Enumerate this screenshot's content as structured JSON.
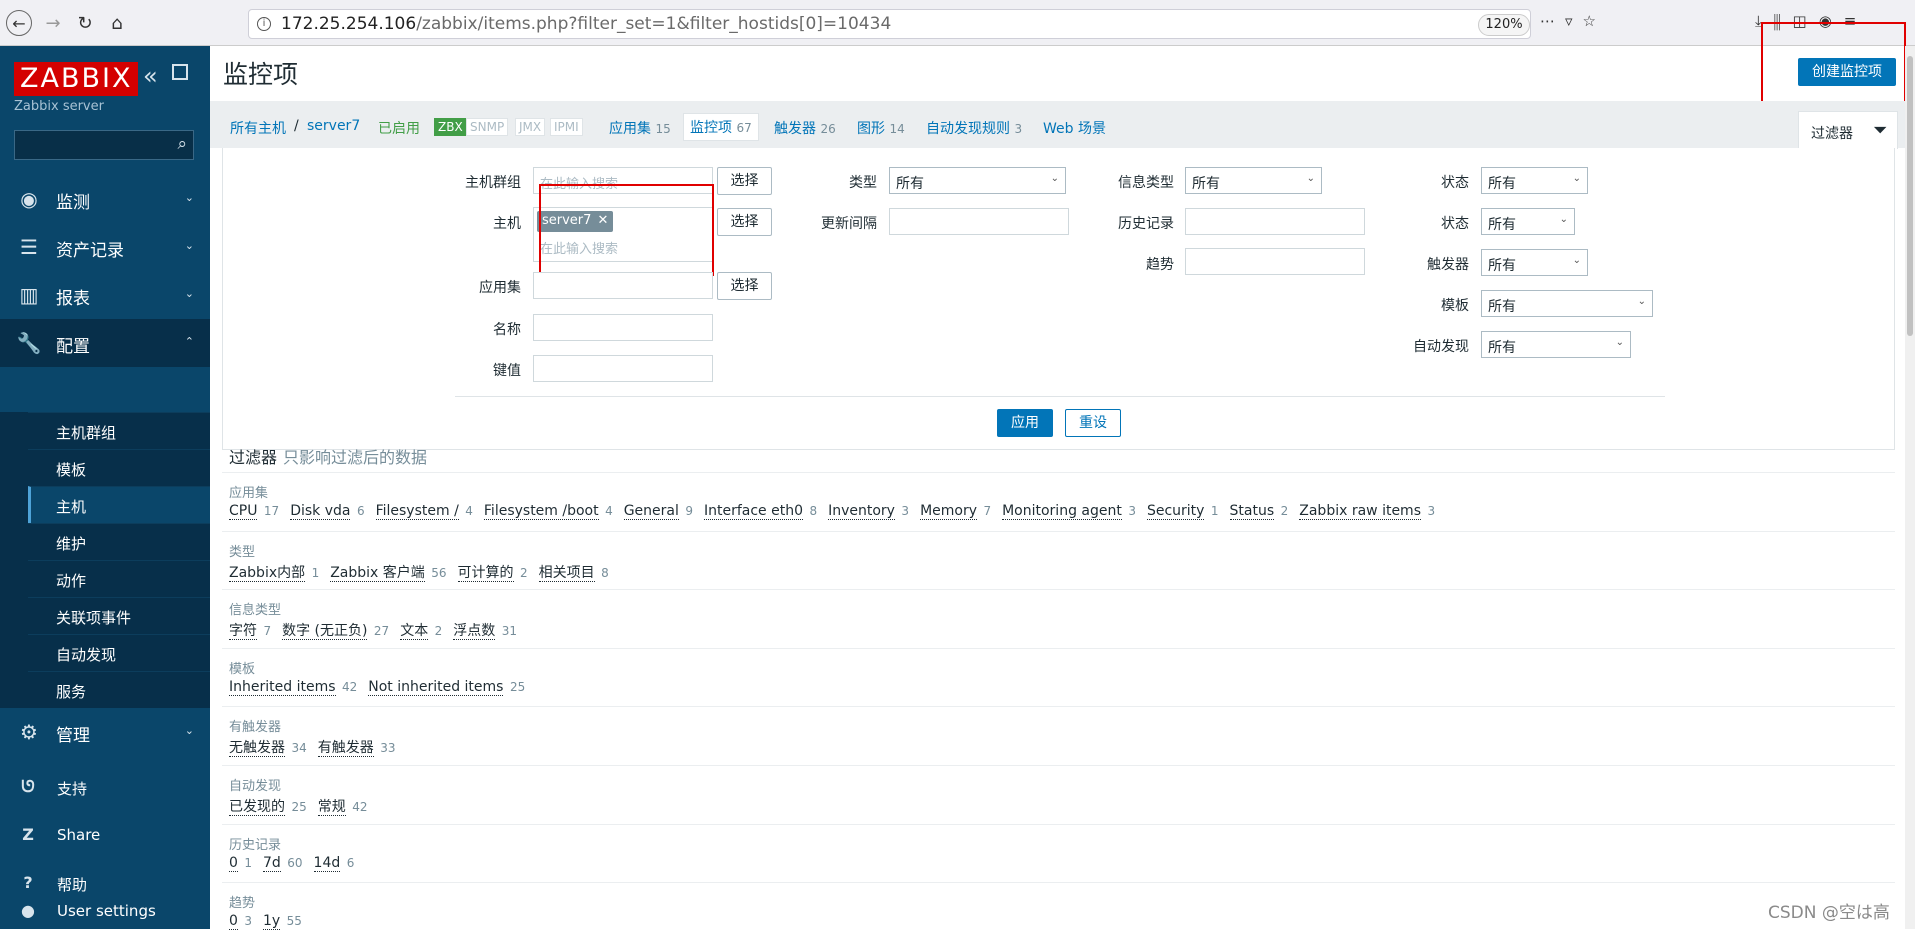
{
  "browser": {
    "url_host": "172.25.254.106",
    "url_rest": "/zabbix/items.php?filter_set=1&filter_hostids[0]=10434",
    "zoom": "120%"
  },
  "sidebar": {
    "logo": "ZABBIX",
    "server_name": "Zabbix server",
    "search_placeholder": "",
    "menu": [
      {
        "label": "监测",
        "icon": "eye-icon"
      },
      {
        "label": "资产记录",
        "icon": "list-icon"
      },
      {
        "label": "报表",
        "icon": "bar-chart-icon"
      },
      {
        "label": "配置",
        "icon": "wrench-icon"
      },
      {
        "label": "管理",
        "icon": "gear-icon"
      }
    ],
    "submenu": [
      "主机群组",
      "模板",
      "主机",
      "维护",
      "动作",
      "关联项事件",
      "自动发现",
      "服务"
    ],
    "footer": [
      {
        "label": "支持",
        "icon": "headset-icon"
      },
      {
        "label": "Share",
        "icon": "share-icon"
      },
      {
        "label": "帮助",
        "icon": "help-icon"
      },
      {
        "label": "User settings",
        "icon": "user-icon"
      }
    ]
  },
  "header": {
    "title": "监控项",
    "create_button": "创建监控项"
  },
  "host_nav": {
    "all_hosts": "所有主机",
    "separator": "/",
    "host": "server7",
    "enabled": "已启用",
    "tags": [
      "ZBX",
      "SNMP",
      "JMX",
      "IPMI"
    ],
    "tabs": [
      {
        "label": "应用集",
        "count": "15"
      },
      {
        "label": "监控项",
        "count": "67"
      },
      {
        "label": "触发器",
        "count": "26"
      },
      {
        "label": "图形",
        "count": "14"
      },
      {
        "label": "自动发现规则",
        "count": "3"
      },
      {
        "label": "Web 场景",
        "count": ""
      }
    ],
    "filter_tab": "过滤器"
  },
  "filter": {
    "host_group_label": "主机群组",
    "host_label": "主机",
    "application_label": "应用集",
    "name_label": "名称",
    "key_label": "键值",
    "search_placeholder": "在此输入搜索",
    "select_button": "选择",
    "host_chip": "server7",
    "type_label": "类型",
    "type_value": "所有",
    "update_interval_label": "更新间隔",
    "info_type_label": "信息类型",
    "info_type_value": "所有",
    "history_label": "历史记录",
    "trends_label": "趋势",
    "state_label": "状态",
    "state_value": "所有",
    "status_label": "状态",
    "status_value": "所有",
    "triggers_label": "触发器",
    "triggers_value": "所有",
    "template_label": "模板",
    "template_value": "所有",
    "discovery_label": "自动发现",
    "discovery_value": "所有",
    "apply_button": "应用",
    "reset_button": "重设"
  },
  "subfilter": {
    "title": "过滤器",
    "subtitle": "只影响过滤后的数据",
    "rows": [
      {
        "label": "应用集",
        "items": [
          {
            "name": "CPU",
            "count": "17"
          },
          {
            "name": "Disk vda",
            "count": "6"
          },
          {
            "name": "Filesystem /",
            "count": "4"
          },
          {
            "name": "Filesystem /boot",
            "count": "4"
          },
          {
            "name": "General",
            "count": "9"
          },
          {
            "name": "Interface eth0",
            "count": "8"
          },
          {
            "name": "Inventory",
            "count": "3"
          },
          {
            "name": "Memory",
            "count": "7"
          },
          {
            "name": "Monitoring agent",
            "count": "3"
          },
          {
            "name": "Security",
            "count": "1"
          },
          {
            "name": "Status",
            "count": "2"
          },
          {
            "name": "Zabbix raw items",
            "count": "3"
          }
        ]
      },
      {
        "label": "类型",
        "items": [
          {
            "name": "Zabbix内部",
            "count": "1"
          },
          {
            "name": "Zabbix 客户端",
            "count": "56"
          },
          {
            "name": "可计算的",
            "count": "2"
          },
          {
            "name": "相关项目",
            "count": "8"
          }
        ]
      },
      {
        "label": "信息类型",
        "items": [
          {
            "name": "字符",
            "count": "7"
          },
          {
            "name": "数字 (无正负)",
            "count": "27"
          },
          {
            "name": "文本",
            "count": "2"
          },
          {
            "name": "浮点数",
            "count": "31"
          }
        ]
      },
      {
        "label": "模板",
        "items": [
          {
            "name": "Inherited items",
            "count": "42"
          },
          {
            "name": "Not inherited items",
            "count": "25"
          }
        ]
      },
      {
        "label": "有触发器",
        "items": [
          {
            "name": "无触发器",
            "count": "34"
          },
          {
            "name": "有触发器",
            "count": "33"
          }
        ]
      },
      {
        "label": "自动发现",
        "items": [
          {
            "name": "已发现的",
            "count": "25"
          },
          {
            "name": "常规",
            "count": "42"
          }
        ]
      },
      {
        "label": "历史记录",
        "items": [
          {
            "name": "0",
            "count": "1"
          },
          {
            "name": "7d",
            "count": "60"
          },
          {
            "name": "14d",
            "count": "6"
          }
        ]
      },
      {
        "label": "趋势",
        "items": [
          {
            "name": "0",
            "count": "3"
          },
          {
            "name": "1y",
            "count": "55"
          }
        ]
      }
    ]
  },
  "watermark": "CSDN @空は高"
}
